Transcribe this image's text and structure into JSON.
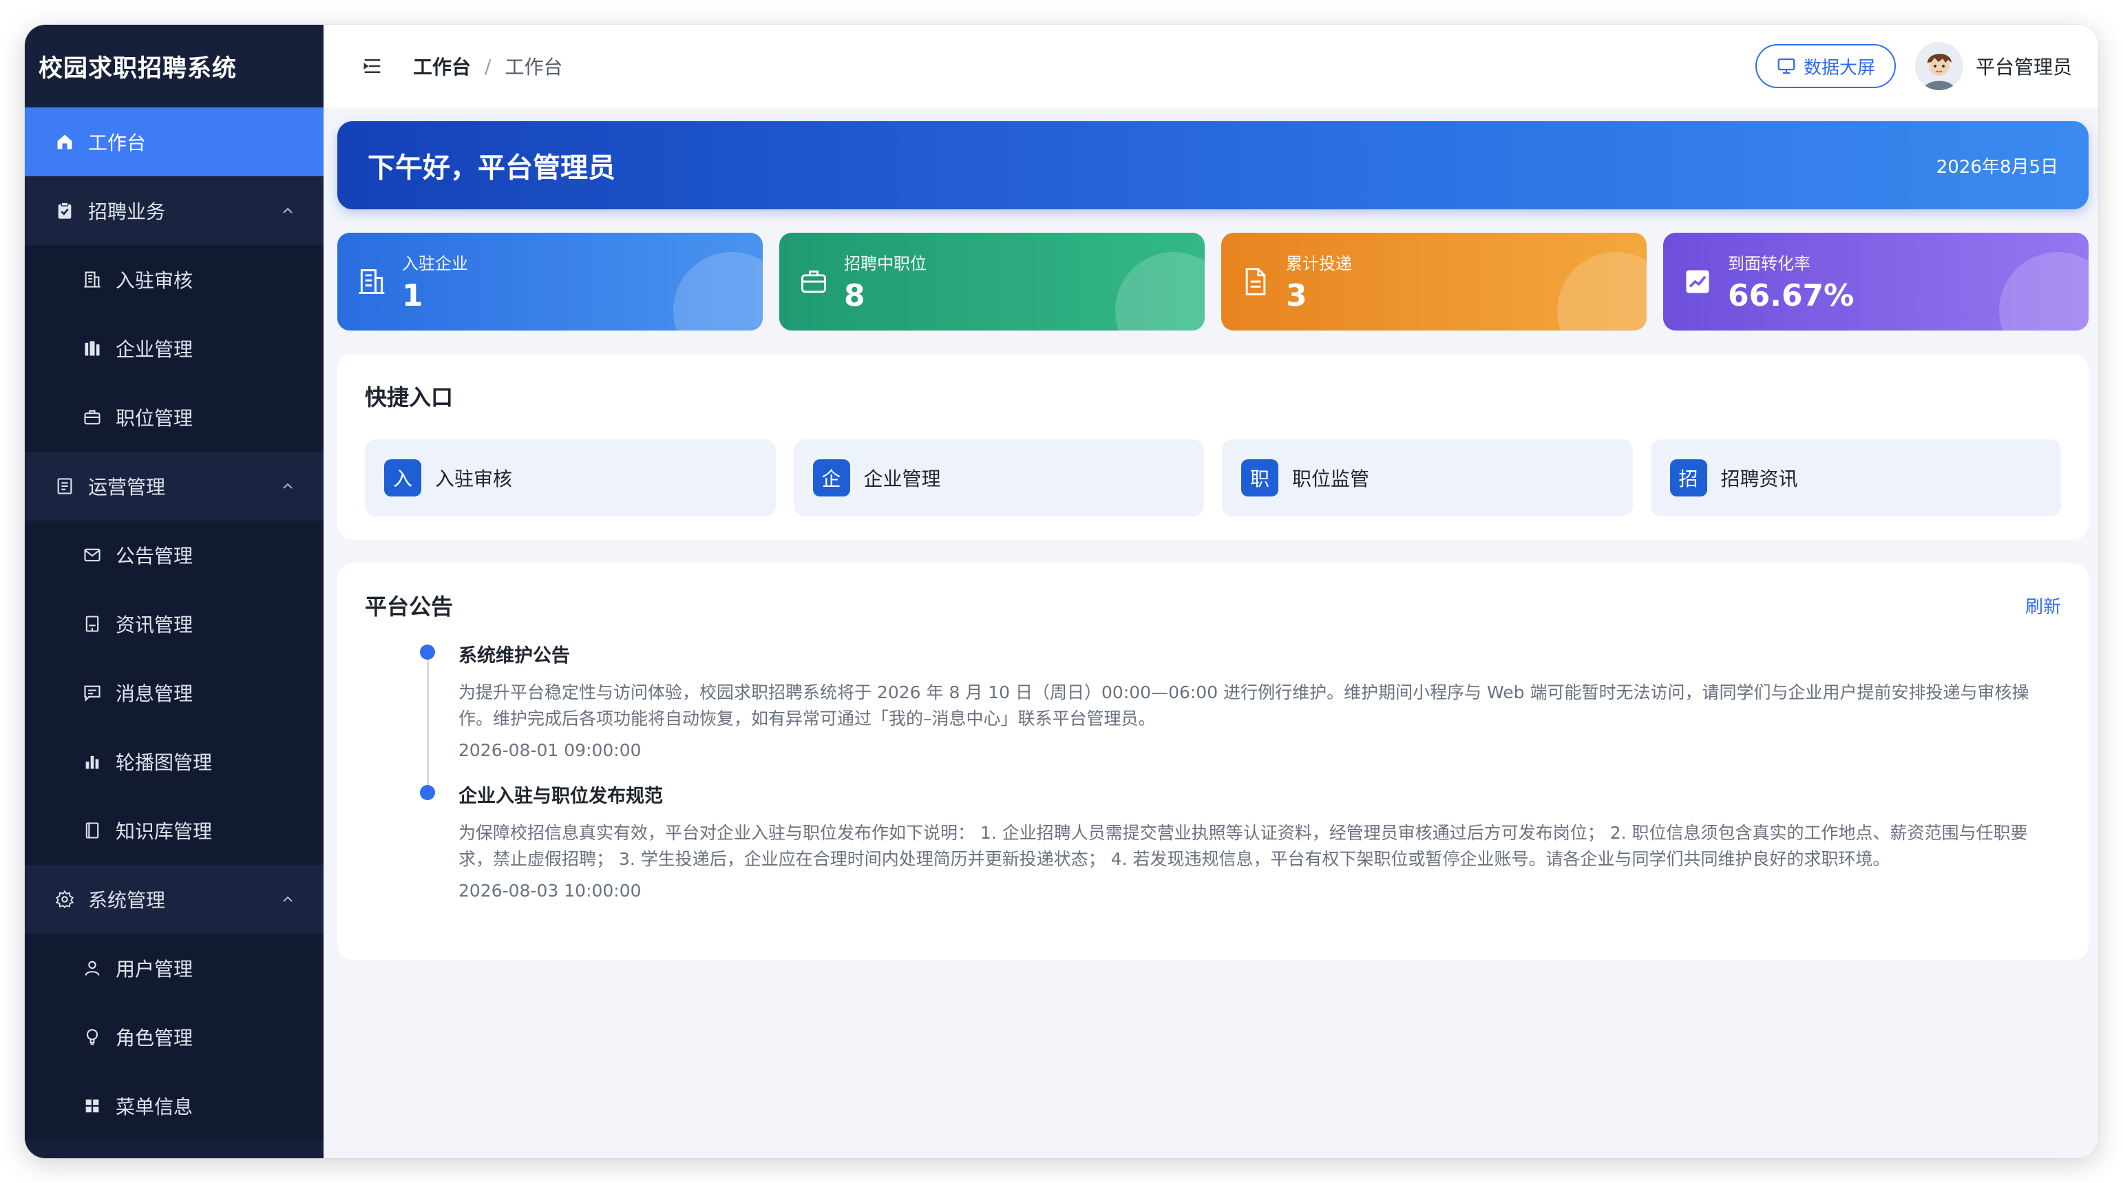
{
  "sidebar": {
    "title": "校园求职招聘系统",
    "items": [
      {
        "label": "工作台"
      },
      {
        "label": "招聘业务"
      },
      {
        "label": "入驻审核"
      },
      {
        "label": "企业管理"
      },
      {
        "label": "职位管理"
      },
      {
        "label": "运营管理"
      },
      {
        "label": "公告管理"
      },
      {
        "label": "资讯管理"
      },
      {
        "label": "消息管理"
      },
      {
        "label": "轮播图管理"
      },
      {
        "label": "知识库管理"
      },
      {
        "label": "系统管理"
      },
      {
        "label": "用户管理"
      },
      {
        "label": "角色管理"
      },
      {
        "label": "菜单信息"
      }
    ]
  },
  "header": {
    "breadcrumb_current": "工作台",
    "breadcrumb_sep": "/",
    "breadcrumb_page": "工作台",
    "bigscreen_label": "数据大屏",
    "username": "平台管理员"
  },
  "welcome": {
    "greeting": "下午好，平台管理员",
    "date": "2026年8月5日"
  },
  "stats": [
    {
      "label": "入驻企业",
      "value": "1"
    },
    {
      "label": "招聘中职位",
      "value": "8"
    },
    {
      "label": "累计投递",
      "value": "3"
    },
    {
      "label": "到面转化率",
      "value": "66.67%"
    }
  ],
  "quick": {
    "title": "快捷入口",
    "items": [
      {
        "badge": "入",
        "label": "入驻审核"
      },
      {
        "badge": "企",
        "label": "企业管理"
      },
      {
        "badge": "职",
        "label": "职位监管"
      },
      {
        "badge": "招",
        "label": "招聘资讯"
      }
    ]
  },
  "notices": {
    "title": "平台公告",
    "refresh": "刷新",
    "items": [
      {
        "title": "系统维护公告",
        "body": "为提升平台稳定性与访问体验，校园求职招聘系统将于 2026 年 8 月 10 日（周日）00:00—06:00 进行例行维护。维护期间小程序与 Web 端可能暂时无法访问，请同学们与企业用户提前安排投递与审核操作。维护完成后各项功能将自动恢复，如有异常可通过「我的–消息中心」联系平台管理员。",
        "time": "2026-08-01 09:00:00"
      },
      {
        "title": "企业入驻与职位发布规范",
        "body": "为保障校招信息真实有效，平台对企业入驻与职位发布作如下说明： 1. 企业招聘人员需提交营业执照等认证资料，经管理员审核通过后方可发布岗位； 2. 职位信息须包含真实的工作地点、薪资范围与任职要求，禁止虚假招聘； 3. 学生投递后，企业应在合理时间内处理简历并更新投递状态； 4. 若发现违规信息，平台有权下架职位或暂停企业账号。请各企业与同学们共同维护良好的求职环境。",
        "time": "2026-08-03 10:00:00"
      }
    ]
  },
  "colors": {
    "sidebar_bg": "#17203a",
    "active": "#3d7cf5",
    "accent": "#2f6cf0"
  }
}
